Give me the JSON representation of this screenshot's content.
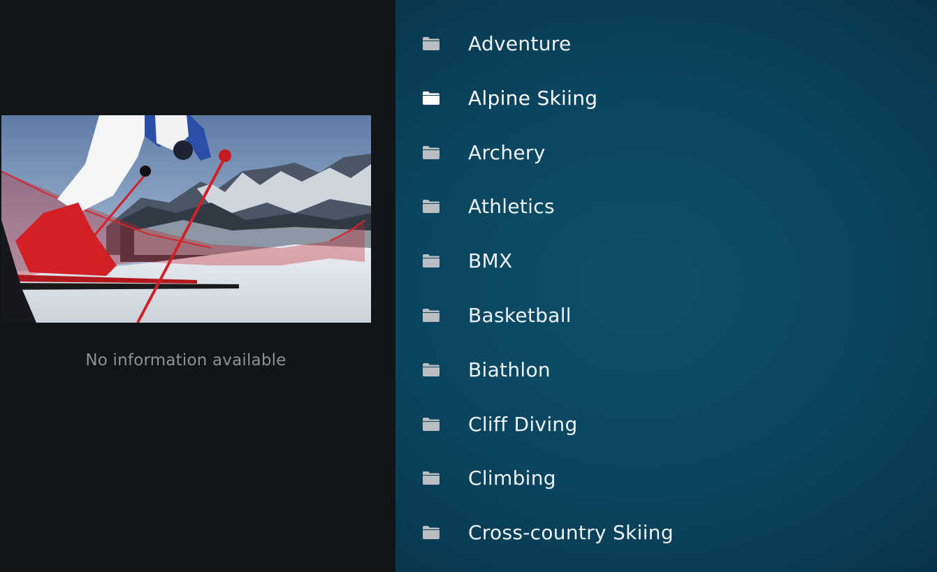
{
  "info_panel": {
    "thumbnail": "alpine-skiing-thumbnail",
    "no_info_text": "No information available"
  },
  "list": {
    "items": [
      {
        "label": "Adventure",
        "icon": "folder-icon",
        "focused": false
      },
      {
        "label": "Alpine Skiing",
        "icon": "folder-icon",
        "focused": true
      },
      {
        "label": "Archery",
        "icon": "folder-icon",
        "focused": false
      },
      {
        "label": "Athletics",
        "icon": "folder-icon",
        "focused": false
      },
      {
        "label": "BMX",
        "icon": "folder-icon",
        "focused": false
      },
      {
        "label": "Basketball",
        "icon": "folder-icon",
        "focused": false
      },
      {
        "label": "Biathlon",
        "icon": "folder-icon",
        "focused": false
      },
      {
        "label": "Cliff Diving",
        "icon": "folder-icon",
        "focused": false
      },
      {
        "label": "Climbing",
        "icon": "folder-icon",
        "focused": false
      },
      {
        "label": "Cross-country Skiing",
        "icon": "folder-icon",
        "focused": false
      }
    ]
  },
  "colors": {
    "left_background": "#101518",
    "right_background": "#0b4560",
    "folder_icon": "#b9bec2",
    "folder_icon_focused": "#ffffff",
    "label_text": "#eef3f5",
    "muted_text": "#8d9296"
  }
}
